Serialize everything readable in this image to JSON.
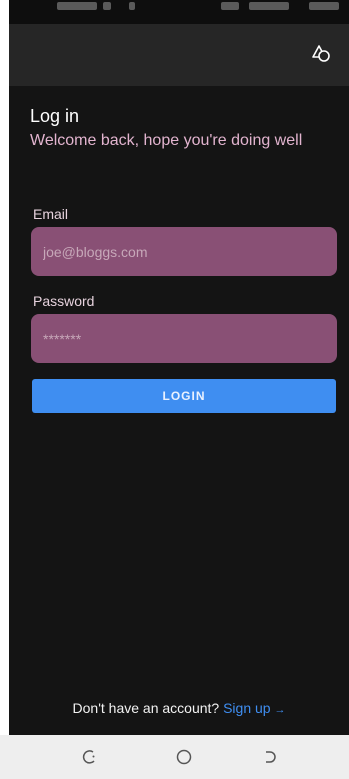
{
  "header": {
    "theme_icon": "theme-toggle-icon"
  },
  "login": {
    "title": "Log in",
    "subtitle": "Welcome back, hope you're doing well",
    "email": {
      "label": "Email",
      "value": "",
      "placeholder": "joe@bloggs.com"
    },
    "password": {
      "label": "Password",
      "value": "",
      "placeholder": "*******"
    },
    "submit_label": "LOGIN"
  },
  "footer": {
    "prompt": "Don't have an account? ",
    "link_label": "Sign up",
    "link_arrow": "→"
  },
  "nav_bar": {
    "icons": [
      "recent-apps-icon",
      "home-icon",
      "back-icon"
    ]
  },
  "colors": {
    "background": "#141414",
    "app_bar": "#262626",
    "accent": "#3f8ef1",
    "field": "#895075",
    "subtitle": "#e2b4cf"
  }
}
